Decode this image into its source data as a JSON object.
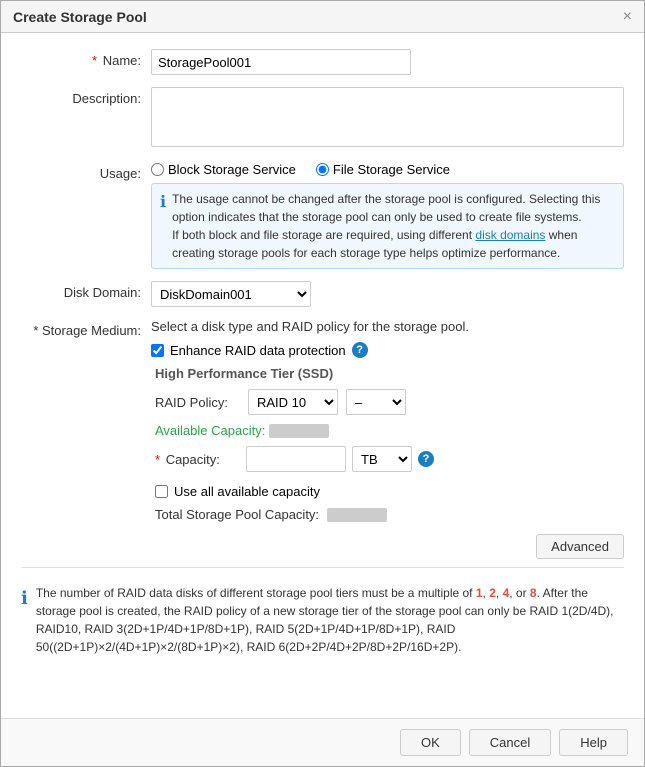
{
  "dialog": {
    "title": "Create Storage Pool",
    "close_label": "×"
  },
  "form": {
    "name_label": "Name:",
    "name_required": "*",
    "name_value": "StoragePool001",
    "description_label": "Description:",
    "usage_label": "Usage:",
    "usage_option_block": "Block Storage Service",
    "usage_option_file": "File Storage Service",
    "usage_info_line1": "The usage cannot be changed after the storage pool is configured. Selecting this option indicates that the storage pool can only be used to create file systems.",
    "usage_info_line2": "If both block and file storage are required, using different disk domains when creating storage pools for each storage type helps optimize performance.",
    "disk_domain_label": "Disk Domain:",
    "disk_domain_value": "DiskDomain001",
    "storage_medium_label": "* Storage Medium:",
    "storage_medium_hint": "Select a disk type and RAID policy for the storage pool.",
    "enhance_raid_label": "Enhance RAID data protection",
    "tier_label": "High Performance Tier (SSD)",
    "raid_policy_label": "RAID Policy:",
    "raid_policy_value": "RAID 10",
    "raid_dash": "–",
    "available_capacity_label": "Available Capacity:",
    "available_capacity_blurred": true,
    "capacity_label": "Capacity:",
    "capacity_required": "*",
    "capacity_value": "",
    "capacity_unit": "TB",
    "use_all_label": "Use all available capacity",
    "total_label": "Total Storage Pool Capacity:",
    "total_blurred": true,
    "advanced_btn": "Advanced",
    "info_text": "The number of RAID data disks of different storage pool tiers must be a multiple of 1, 2, 4, or 8. After the storage pool is created, the RAID policy of a new storage tier of the storage pool can only be RAID 1(2D/4D), RAID10, RAID 3(2D+1P/4D+1P/8D+1P), RAID 5(2D+1P/4D+1P/8D+1P), RAID 50((2D+1P)×2/(4D+1P)×2/(8D+1P)×2), RAID 6(2D+2P/4D+2P/8D+2P/16D+2P).",
    "info_highlights": [
      "1",
      "2",
      "4",
      "8"
    ]
  },
  "footer": {
    "ok_label": "OK",
    "cancel_label": "Cancel",
    "help_label": "Help"
  }
}
